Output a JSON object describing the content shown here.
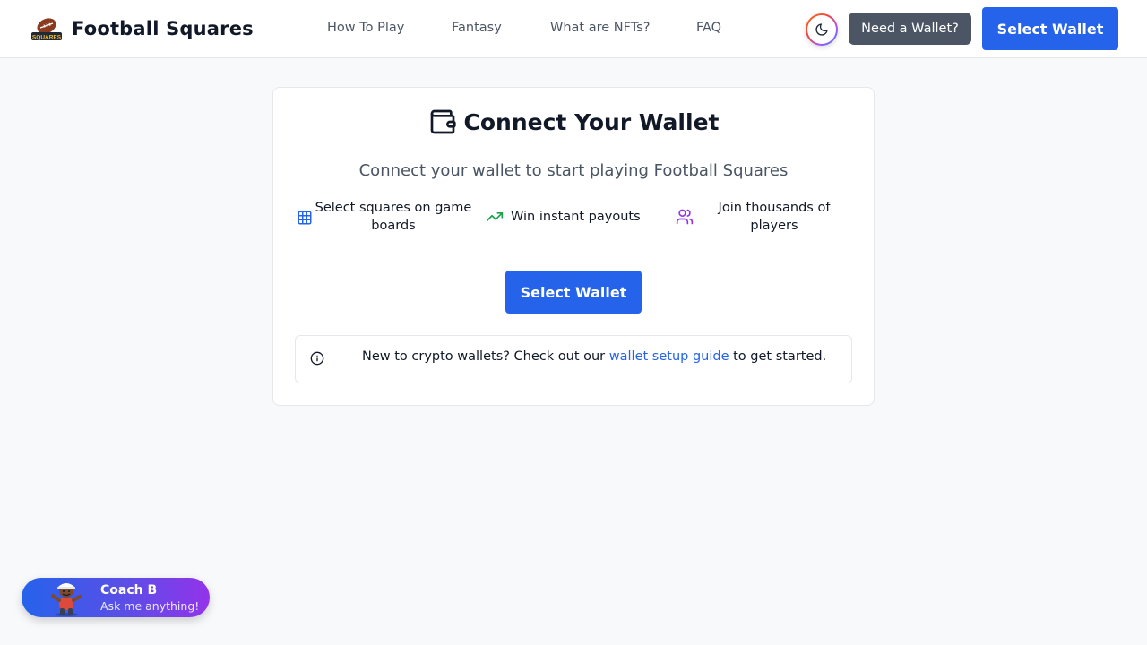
{
  "header": {
    "brand_name": "Football Squares",
    "logo_icon": "football-logo",
    "nav": [
      {
        "label": "How To Play"
      },
      {
        "label": "Fantasy"
      },
      {
        "label": "What are NFTs?"
      },
      {
        "label": "FAQ"
      }
    ],
    "theme_icon": "moon-icon",
    "need_wallet_label": "Need a Wallet?",
    "select_wallet_label": "Select Wallet"
  },
  "card": {
    "title_icon": "wallet-icon",
    "title": "Connect Your Wallet",
    "subtitle": "Connect your wallet to start playing Football Squares",
    "features": [
      {
        "icon": "grid-icon",
        "text": "Select squares on game boards",
        "color": "#2563eb"
      },
      {
        "icon": "trending-up-icon",
        "text": "Win instant payouts",
        "color": "#16a34a"
      },
      {
        "icon": "users-icon",
        "text": "Join thousands of players",
        "color": "#9333ea"
      }
    ],
    "select_wallet_label": "Select Wallet",
    "notice": {
      "icon": "info-icon",
      "before": "New to crypto wallets? Check out our ",
      "link": "wallet setup guide",
      "after": " to get started."
    }
  },
  "coach": {
    "name": "Coach B",
    "subtitle": "Ask me anything!",
    "avatar_icon": "coach-avatar"
  },
  "colors": {
    "primary": "#2563eb",
    "dark_button": "#4b5563",
    "background": "#f8f9fb"
  }
}
